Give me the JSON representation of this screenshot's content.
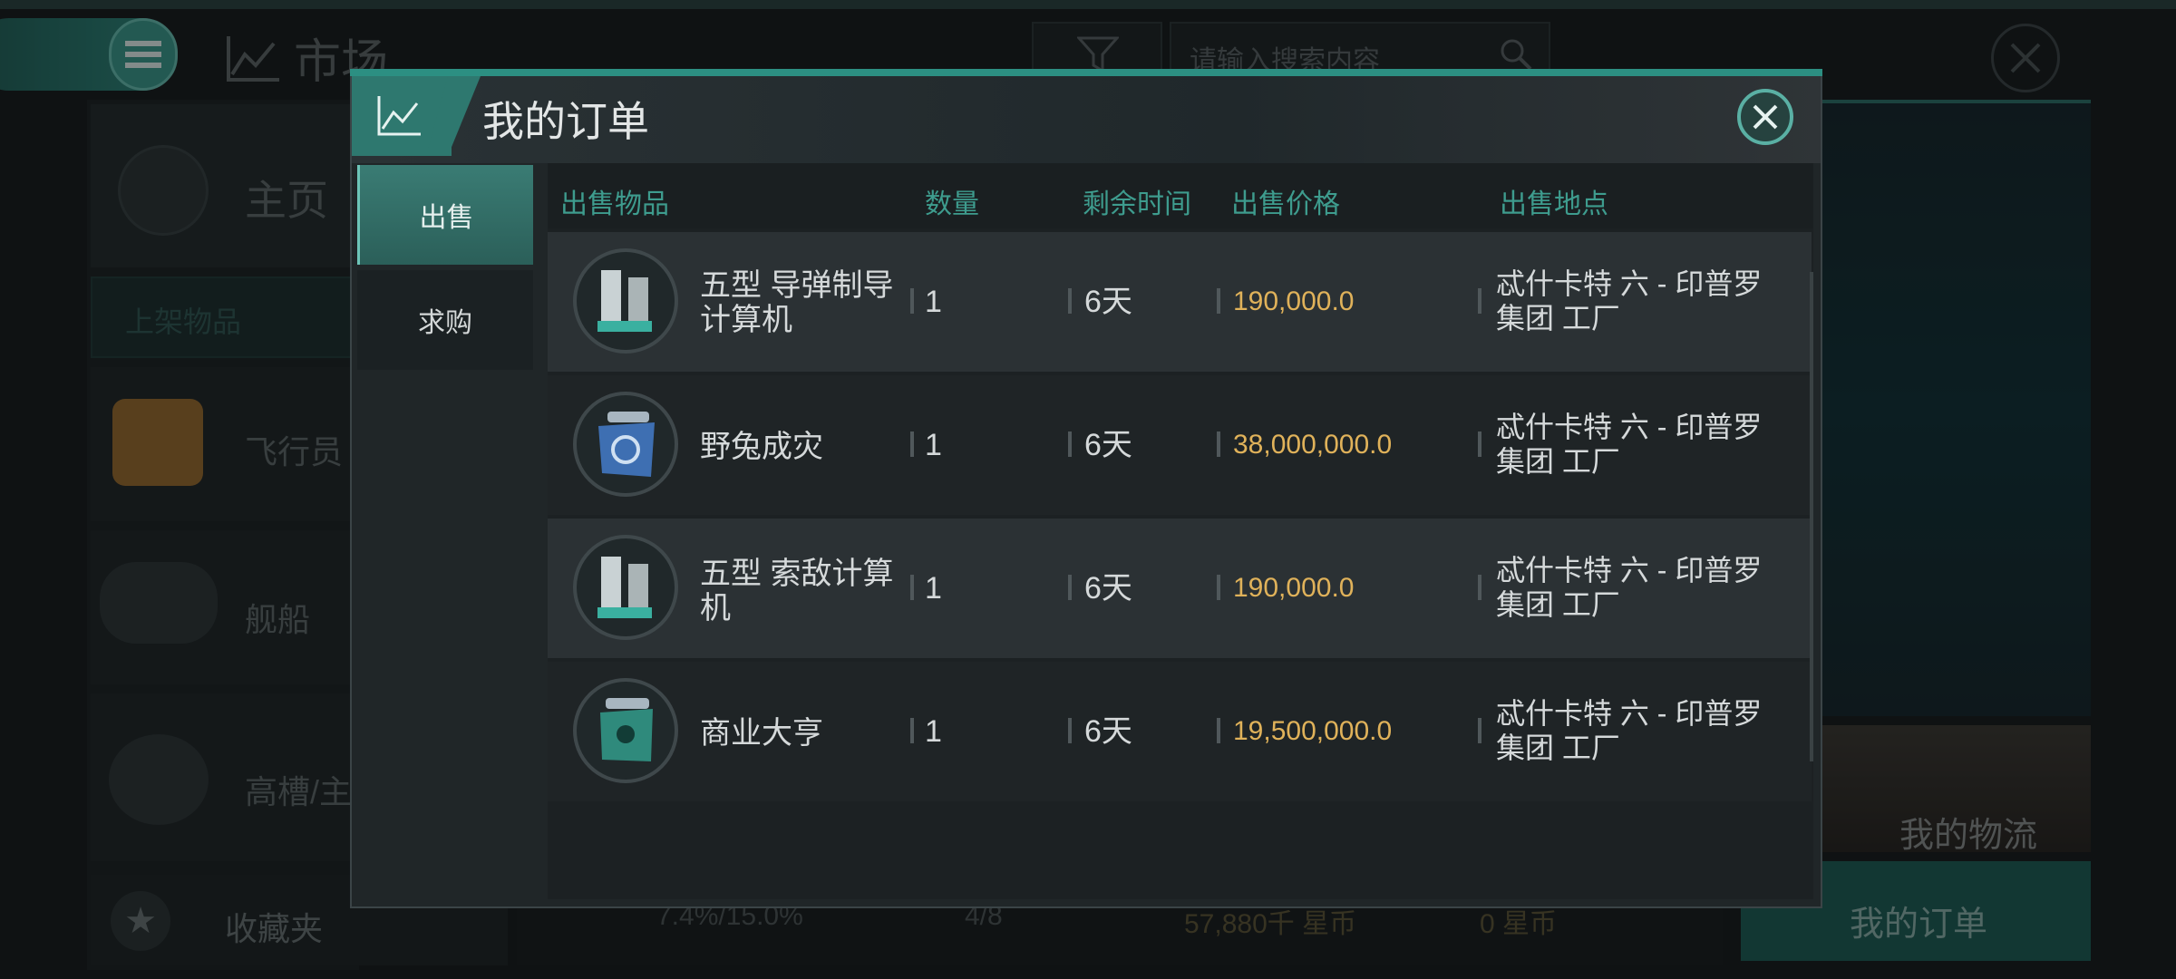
{
  "background": {
    "market_title": "市场",
    "search_placeholder": "请输入搜索内容",
    "sidebar_home": "主页",
    "sidebar_shelf": "上架物品",
    "categories": [
      "飞行员",
      "舰船",
      "高槽/主"
    ],
    "favorites": "收藏夹",
    "stats": {
      "tax": "7.4%/15.0%",
      "orders": "4/8",
      "balance": "57,880千 星币",
      "escrow": "0 星币"
    },
    "my_logistics": "我的物流",
    "my_orders_button": "我的订单"
  },
  "modal": {
    "title": "我的订单",
    "tabs": [
      {
        "label": "出售",
        "active": true
      },
      {
        "label": "求购",
        "active": false
      }
    ],
    "columns": [
      "出售物品",
      "数量",
      "剩余时间",
      "出售价格",
      "出售地点"
    ],
    "rows": [
      {
        "icon": "computer-module-icon",
        "name": "五型 导弹制导\n计算机",
        "qty": "1",
        "time": "6天",
        "price": "190,000.0",
        "location": "忒什卡特 六 - 印普罗\n集团 工厂"
      },
      {
        "icon": "skill-chip-icon",
        "name": "野兔成灾",
        "qty": "1",
        "time": "6天",
        "price": "38,000,000.0",
        "location": "忒什卡特 六 - 印普罗\n集团 工厂"
      },
      {
        "icon": "computer-module-icon",
        "name": "五型 索敌计算\n机",
        "qty": "1",
        "time": "6天",
        "price": "190,000.0",
        "location": "忒什卡特 六 - 印普罗\n集团 工厂"
      },
      {
        "icon": "license-card-icon",
        "name": "商业大亨",
        "qty": "1",
        "time": "6天",
        "price": "19,500,000.0",
        "location": "忒什卡特 六 - 印普罗\n集团 工厂"
      }
    ]
  },
  "colors": {
    "accent": "#2c8f82",
    "price": "#e0b25a",
    "header_text": "#3e9c8e"
  }
}
